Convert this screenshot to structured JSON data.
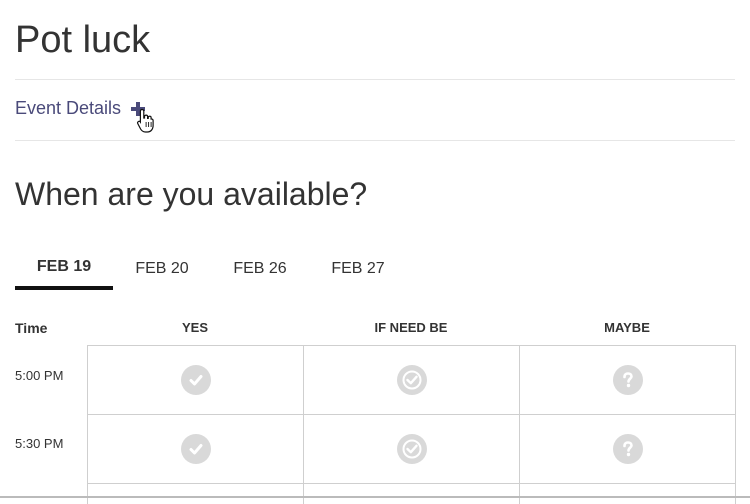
{
  "page": {
    "title": "Pot luck"
  },
  "details": {
    "label": "Event Details"
  },
  "availability": {
    "heading": "When are you available?"
  },
  "tabs": [
    {
      "label": "FEB 19",
      "active": true
    },
    {
      "label": "FEB 20",
      "active": false
    },
    {
      "label": "FEB 26",
      "active": false
    },
    {
      "label": "FEB 27",
      "active": false
    }
  ],
  "table": {
    "time_header": "Time",
    "columns": [
      "YES",
      "IF NEED BE",
      "MAYBE"
    ],
    "rows": [
      {
        "time": "5:00 PM"
      },
      {
        "time": "5:30 PM"
      }
    ]
  },
  "colors": {
    "accent": "#4a4a7a",
    "icon_gray": "#d9d9d9",
    "border": "#cfcfcf"
  }
}
